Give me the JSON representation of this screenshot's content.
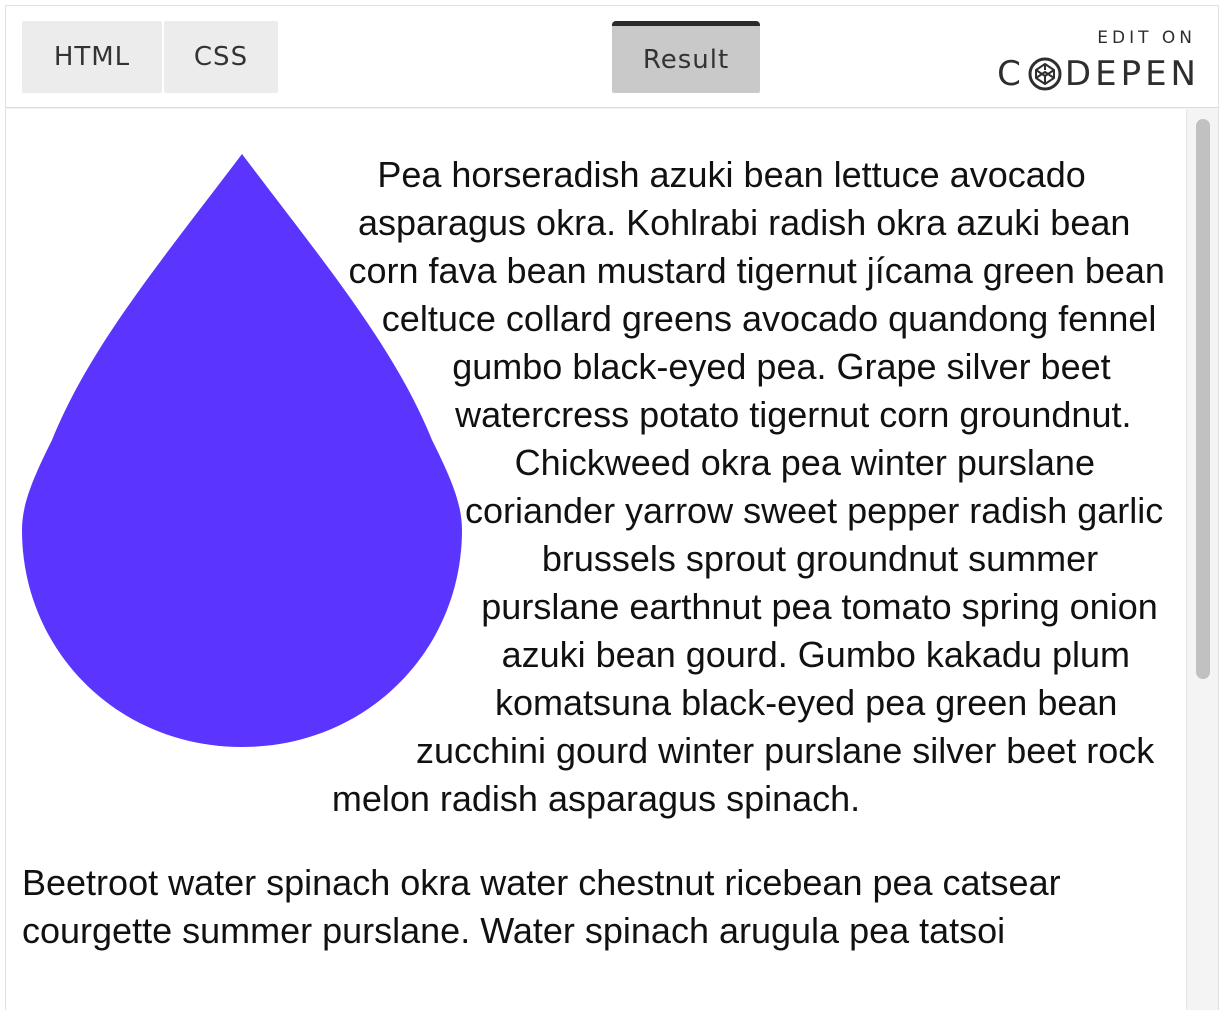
{
  "tabs": {
    "html": "HTML",
    "css": "CSS",
    "result": "Result"
  },
  "codepen": {
    "edit_on": "EDIT ON",
    "logo_left": "C",
    "logo_right": "DEPEN"
  },
  "colors": {
    "drop": "#5b35fd",
    "active_tab": "#c9c9c9",
    "tab": "#ececec"
  },
  "content": {
    "paragraph1": "Pea horseradish azuki bean lettuce avocado asparagus okra. Kohlrabi radish okra azuki bean corn fava bean mustard tigernut jícama green bean celtuce collard greens avocado quandong fennel gumbo black-eyed pea. Grape silver beet watercress potato tigernut corn groundnut. Chickweed okra pea winter purslane coriander yarrow sweet pepper radish garlic brussels sprout groundnut summer purslane earthnut pea tomato spring onion azuki bean gourd. Gumbo kakadu plum komatsuna black-eyed pea green bean zucchini gourd winter purslane silver beet rock melon radish asparagus spinach.",
    "paragraph2": "Beetroot water spinach okra water chestnut ricebean pea catsear courgette summer purslane. Water spinach arugula pea tatsoi"
  }
}
